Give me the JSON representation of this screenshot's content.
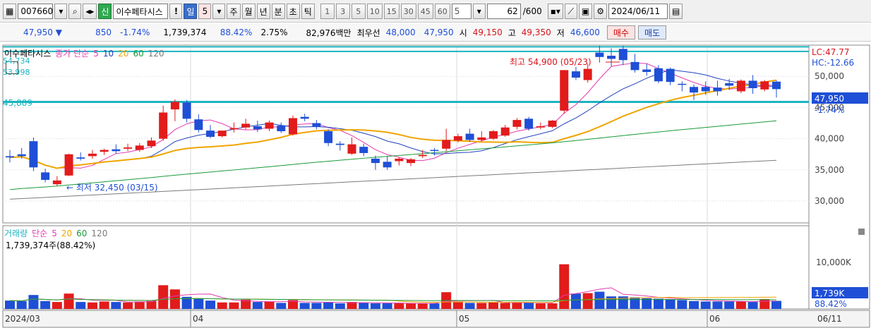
{
  "toolbar": {
    "stock_code": "007660",
    "credit_badge": "신",
    "stock_name": "이수페타시스",
    "period_buttons": [
      "일",
      "5",
      "주",
      "월",
      "년",
      "분",
      "초",
      "틱"
    ],
    "minute_buttons": [
      "1",
      "3",
      "5",
      "10",
      "15",
      "30",
      "45",
      "60"
    ],
    "interval_value": "5",
    "count_value": "62",
    "count_total": "/600",
    "date_value": "2024/06/11"
  },
  "quote": {
    "price": "47,950",
    "change": "850",
    "change_pct": "-1.74%",
    "volume": "1,739,374",
    "vol_ratio": "88.42%",
    "turnover": "2.75%",
    "amount": "82,976백만",
    "best_label": "최우선",
    "best_ask": "48,000",
    "best_bid": "47,950",
    "open_label": "시",
    "open": "49,150",
    "high_label": "고",
    "high": "49,350",
    "low_label": "저",
    "low": "46,600",
    "buy_label": "매수",
    "sell_label": "매도"
  },
  "price_legend": {
    "name": "이수페타시스",
    "ma_label": "종가 단순",
    "periods": [
      "5",
      "10",
      "20",
      "60",
      "120"
    ]
  },
  "vol_legend": {
    "name": "거래량",
    "ma_label": "단순",
    "periods": [
      "5",
      "20",
      "60",
      "120"
    ],
    "info": "1,739,374주(88.42%)"
  },
  "right_labels": {
    "lc": "LC:47.77",
    "hc": "HC:-12.66",
    "last_price": "47,950",
    "last_pct": "-1.74%",
    "last_vol": "1,739K",
    "last_vol_pct": "88.42%"
  },
  "level_labels": {
    "l1": "54,734",
    "l2": "53,998",
    "l3": "45,889"
  },
  "annotations": {
    "high": "최고 54,900 (05/23)",
    "low": "최저 32,450 (03/15)"
  },
  "x_labels": [
    "2024/03",
    "04",
    "05",
    "06",
    "06/11"
  ],
  "colors": {
    "up": "#e21b1b",
    "down": "#1f4fd6",
    "ma5": "#e23cb0",
    "ma10": "#2244bb",
    "ma20": "#f0a500",
    "ma60": "#1a9a3a",
    "ma120": "#7a7a7a",
    "level": "#1bb5c0"
  },
  "chart_data": {
    "type": "candlestick",
    "y_ticks": [
      30000,
      35000,
      40000,
      45000,
      50000
    ],
    "y_tick_labels": [
      "30,000",
      "35,000",
      "40,000",
      "45,000",
      "50,000"
    ],
    "ylim": [
      26500,
      55000
    ],
    "vol_ticks_label": "10,000K",
    "levels": [
      54734,
      53998,
      45889
    ],
    "candles": [
      {
        "o": 37200,
        "h": 38200,
        "c": 37000,
        "l": 36200,
        "v": 1800
      },
      {
        "o": 37500,
        "h": 38500,
        "c": 37200,
        "l": 36800,
        "v": 1700
      },
      {
        "o": 39600,
        "h": 40200,
        "c": 35400,
        "l": 34800,
        "v": 3000
      },
      {
        "o": 34600,
        "h": 35200,
        "c": 33400,
        "l": 33000,
        "v": 1700
      },
      {
        "o": 32700,
        "h": 34000,
        "c": 33300,
        "l": 32450,
        "v": 1500
      },
      {
        "o": 34100,
        "h": 37600,
        "c": 37500,
        "l": 34000,
        "v": 3300
      },
      {
        "o": 37000,
        "h": 37800,
        "c": 36800,
        "l": 36500,
        "v": 1500
      },
      {
        "o": 37200,
        "h": 38200,
        "c": 37600,
        "l": 36800,
        "v": 1400
      },
      {
        "o": 37900,
        "h": 38400,
        "c": 38200,
        "l": 37400,
        "v": 1600
      },
      {
        "o": 38300,
        "h": 39100,
        "c": 38000,
        "l": 37600,
        "v": 1500
      },
      {
        "o": 38400,
        "h": 39200,
        "c": 38600,
        "l": 38000,
        "v": 1400
      },
      {
        "o": 38200,
        "h": 39300,
        "c": 38900,
        "l": 37900,
        "v": 1600
      },
      {
        "o": 38800,
        "h": 40200,
        "c": 39700,
        "l": 38500,
        "v": 1700
      },
      {
        "o": 40000,
        "h": 45300,
        "c": 44200,
        "l": 39700,
        "v": 5100
      },
      {
        "o": 44700,
        "h": 46300,
        "c": 45900,
        "l": 42800,
        "v": 4200
      },
      {
        "o": 45800,
        "h": 46200,
        "c": 43200,
        "l": 42600,
        "v": 2600
      },
      {
        "o": 43100,
        "h": 43900,
        "c": 41400,
        "l": 41000,
        "v": 2300
      },
      {
        "o": 41300,
        "h": 42200,
        "c": 40300,
        "l": 40100,
        "v": 1800
      },
      {
        "o": 40400,
        "h": 40900,
        "c": 41300,
        "l": 40200,
        "v": 1400
      },
      {
        "o": 41500,
        "h": 42600,
        "c": 41700,
        "l": 41000,
        "v": 1400
      },
      {
        "o": 41800,
        "h": 43200,
        "c": 42400,
        "l": 41500,
        "v": 2000
      },
      {
        "o": 42000,
        "h": 42900,
        "c": 41500,
        "l": 41100,
        "v": 1500
      },
      {
        "o": 41600,
        "h": 42900,
        "c": 42600,
        "l": 41200,
        "v": 1600
      },
      {
        "o": 42100,
        "h": 42600,
        "c": 41200,
        "l": 40900,
        "v": 1300
      },
      {
        "o": 40700,
        "h": 43700,
        "c": 43300,
        "l": 40500,
        "v": 1900
      },
      {
        "o": 43500,
        "h": 44000,
        "c": 43200,
        "l": 42800,
        "v": 1300
      },
      {
        "o": 42500,
        "h": 43000,
        "c": 41900,
        "l": 41500,
        "v": 1300
      },
      {
        "o": 41200,
        "h": 41500,
        "c": 39300,
        "l": 38800,
        "v": 1400
      },
      {
        "o": 39200,
        "h": 39600,
        "c": 39000,
        "l": 38100,
        "v": 1200
      },
      {
        "o": 37600,
        "h": 40200,
        "c": 39100,
        "l": 37400,
        "v": 1500
      },
      {
        "o": 38700,
        "h": 39200,
        "c": 37700,
        "l": 37200,
        "v": 1300
      },
      {
        "o": 36800,
        "h": 37300,
        "c": 36100,
        "l": 35000,
        "v": 1200
      },
      {
        "o": 36300,
        "h": 37200,
        "c": 35400,
        "l": 35000,
        "v": 1200
      },
      {
        "o": 36400,
        "h": 37000,
        "c": 36800,
        "l": 35700,
        "v": 1200
      },
      {
        "o": 36100,
        "h": 36900,
        "c": 36700,
        "l": 35600,
        "v": 1200
      },
      {
        "o": 37200,
        "h": 38200,
        "c": 37400,
        "l": 36900,
        "v": 1200
      },
      {
        "o": 38200,
        "h": 38500,
        "c": 38100,
        "l": 37300,
        "v": 1200
      },
      {
        "o": 38400,
        "h": 41600,
        "c": 39800,
        "l": 38000,
        "v": 3600
      },
      {
        "o": 39700,
        "h": 40800,
        "c": 40400,
        "l": 39400,
        "v": 1600
      },
      {
        "o": 40800,
        "h": 41600,
        "c": 39800,
        "l": 39500,
        "v": 1300
      },
      {
        "o": 39800,
        "h": 41200,
        "c": 40200,
        "l": 39600,
        "v": 1300
      },
      {
        "o": 40000,
        "h": 41400,
        "c": 41200,
        "l": 39800,
        "v": 1400
      },
      {
        "o": 40500,
        "h": 42200,
        "c": 41800,
        "l": 40300,
        "v": 1300
      },
      {
        "o": 41900,
        "h": 43300,
        "c": 43000,
        "l": 41500,
        "v": 1500
      },
      {
        "o": 43200,
        "h": 43500,
        "c": 41600,
        "l": 41300,
        "v": 1300
      },
      {
        "o": 41800,
        "h": 42600,
        "c": 42000,
        "l": 41500,
        "v": 1200
      },
      {
        "o": 41900,
        "h": 43000,
        "c": 42900,
        "l": 41700,
        "v": 1200
      },
      {
        "o": 44500,
        "h": 51000,
        "c": 51000,
        "l": 44000,
        "v": 9600
      },
      {
        "o": 50800,
        "h": 51500,
        "c": 49800,
        "l": 49400,
        "v": 3300
      },
      {
        "o": 49400,
        "h": 52000,
        "c": 51200,
        "l": 49000,
        "v": 3400
      },
      {
        "o": 53800,
        "h": 54900,
        "c": 53100,
        "l": 52200,
        "v": 3700
      },
      {
        "o": 53300,
        "h": 54500,
        "c": 52800,
        "l": 51600,
        "v": 2700
      },
      {
        "o": 54400,
        "h": 54900,
        "c": 52600,
        "l": 51800,
        "v": 2700
      },
      {
        "o": 52300,
        "h": 53600,
        "c": 51000,
        "l": 50600,
        "v": 2500
      },
      {
        "o": 51100,
        "h": 52000,
        "c": 50700,
        "l": 50100,
        "v": 2300
      },
      {
        "o": 51300,
        "h": 51800,
        "c": 49200,
        "l": 48900,
        "v": 2200
      },
      {
        "o": 51200,
        "h": 51400,
        "c": 49100,
        "l": 48600,
        "v": 2000
      },
      {
        "o": 48800,
        "h": 49200,
        "c": 48700,
        "l": 47600,
        "v": 1900
      },
      {
        "o": 48300,
        "h": 48700,
        "c": 47400,
        "l": 46200,
        "v": 1700
      },
      {
        "o": 48300,
        "h": 49200,
        "c": 47600,
        "l": 47000,
        "v": 1600
      },
      {
        "o": 48200,
        "h": 49300,
        "c": 47600,
        "l": 46900,
        "v": 1600
      },
      {
        "o": 48900,
        "h": 49600,
        "c": 48500,
        "l": 47800,
        "v": 1600
      },
      {
        "o": 47600,
        "h": 49500,
        "c": 49300,
        "l": 47300,
        "v": 1600
      },
      {
        "o": 49300,
        "h": 50200,
        "c": 48100,
        "l": 47200,
        "v": 1500
      },
      {
        "o": 47900,
        "h": 49400,
        "c": 49200,
        "l": 47600,
        "v": 2100
      },
      {
        "o": 49150,
        "h": 49350,
        "c": 47950,
        "l": 46600,
        "v": 1739
      }
    ]
  }
}
